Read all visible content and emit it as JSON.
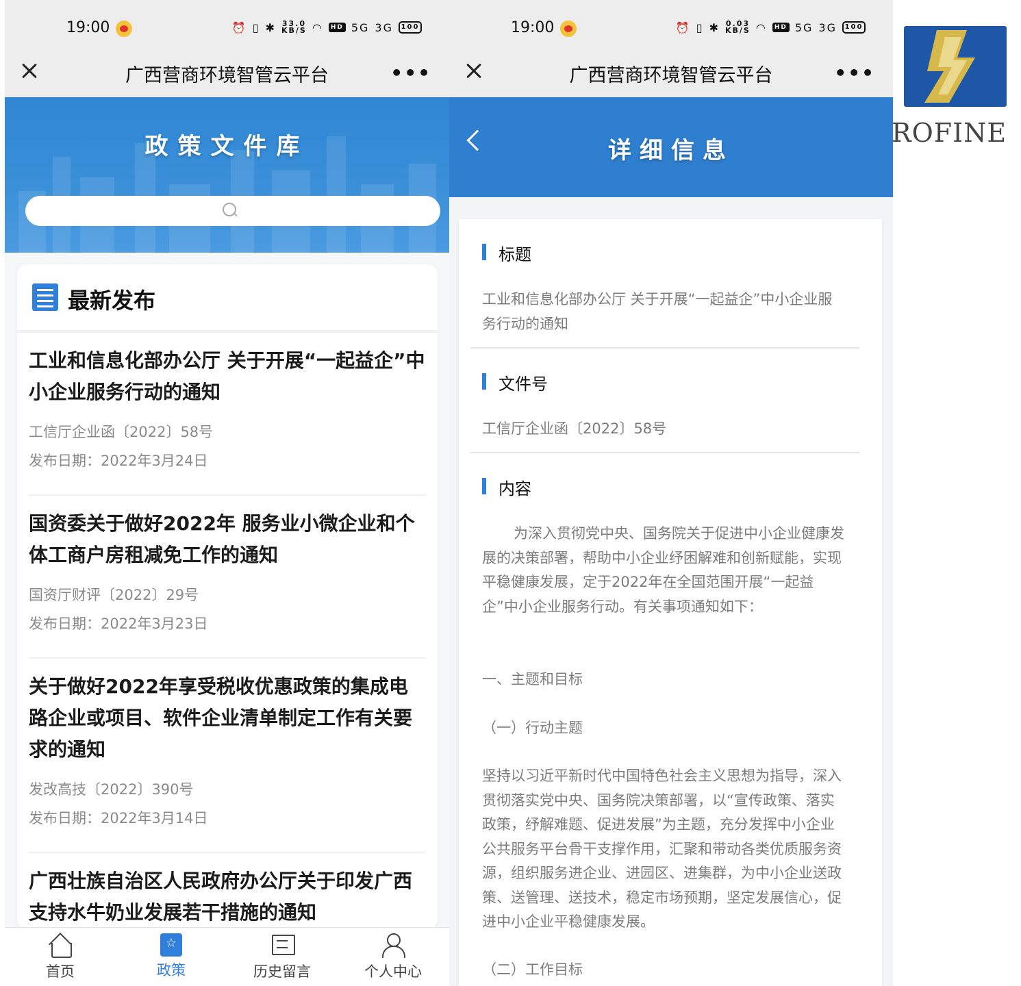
{
  "status_bar": {
    "time": "19:00",
    "left_speed_value": "33.0",
    "right_speed_value": "0.03",
    "speed_unit": "KB/S",
    "hd_label": "HD",
    "signal_1": "5G",
    "signal_2": "3G",
    "battery": "100"
  },
  "app_bar": {
    "title": "广西营商环境智管云平台",
    "more": "•••"
  },
  "policy_page": {
    "banner_title": "政策文件库",
    "search_placeholder": "",
    "section_title": "最新发布",
    "items": [
      {
        "title": "工业和信息化部办公厅 关于开展“一起益企”中小企业服务行动的通知",
        "doc_no": "工信厅企业函〔2022〕58号",
        "date": "发布日期：2022年3月24日"
      },
      {
        "title": "国资委关于做好2022年 服务业小微企业和个体工商户房租减免工作的通知",
        "doc_no": "国资厅财评〔2022〕29号",
        "date": "发布日期：2022年3月23日"
      },
      {
        "title": "关于做好2022年享受税收优惠政策的集成电路企业或项目、软件企业清单制定工作有关要求的通知",
        "doc_no": "发改高技〔2022〕390号",
        "date": "发布日期：2022年3月14日"
      },
      {
        "title": "广西壮族自治区人民政府办公厅关于印发广西支持水牛奶业发展若干措施的通知"
      }
    ],
    "tabs": [
      {
        "label": "首页",
        "icon": "home-icon"
      },
      {
        "label": "政策",
        "icon": "policy-icon"
      },
      {
        "label": "历史留言",
        "icon": "message-icon"
      },
      {
        "label": "个人中心",
        "icon": "user-icon"
      }
    ],
    "active_tab": "政策",
    "accent_color": "#2f7fdb"
  },
  "detail_page": {
    "banner_title": "详细信息",
    "title_label": "标题",
    "title_value": "工业和信息化部办公厅 关于开展“一起益企”中小企业服务行动的通知",
    "doc_no_label": "文件号",
    "doc_no_value": "工信厅企业函〔2022〕58号",
    "content_label": "内容",
    "content_intro": "为深入贯彻党中央、国务院关于促进中小企业健康发展的决策部署，帮助中小企业纾困解难和创新赋能，实现平稳健康发展，定于2022年在全国范围开展“一起益企”中小企业服务行动。有关事项通知如下：",
    "heading_1": "一、主题和目标",
    "heading_1_1": "（一）行动主题",
    "paragraph_1": "坚持以习近平新时代中国特色社会主义思想为指导，深入贯彻落实党中央、国务院决策部署，以“宣传政策、落实政策，纾解难题、促进发展”为主题，充分发挥中小企业公共服务平台骨干支撑作用，汇聚和带动各类优质服务资源，组织服务进企业、进园区、进集群，为中小企业送政策、送管理、送技术，稳定市场预期，坚定发展信心，促进中小企业平稳健康发展。",
    "heading_1_2": "（二）工作目标"
  },
  "logo": {
    "text": "ROFINE",
    "colors": {
      "blue": "#1d57a6",
      "gold": "#d6b94a"
    }
  }
}
